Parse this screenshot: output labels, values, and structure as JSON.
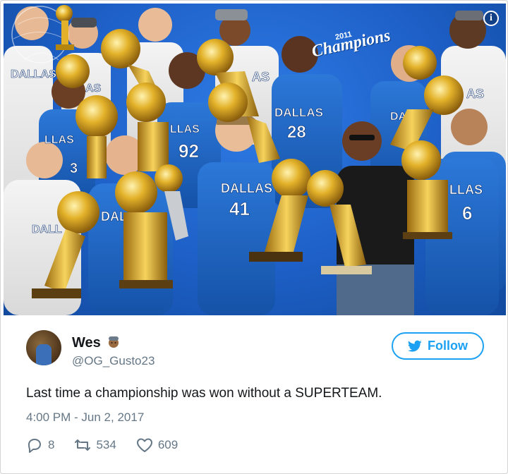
{
  "photo": {
    "info_icon_label": "i",
    "logo": {
      "year": "2011",
      "word": "Champions"
    },
    "jerseys": {
      "team": "DALLAS",
      "team_partial_1": "DALLAS",
      "team_partial_2": "LLAS",
      "team_partial_3": "DALL",
      "team_partial_4": "LLAS",
      "team_partial_5": "DAL",
      "team_partial_6": "DALL",
      "team_partial_7": "LLAS",
      "team_partial_8": "AS",
      "team_partial_9": "AS",
      "team_partial_10": "LLAS",
      "num_3": "3",
      "num_92": "92",
      "num_28": "28",
      "num_41": "41",
      "num_6": "6"
    }
  },
  "tweet": {
    "display_name": "Wes",
    "handle": "@OG_Gusto23",
    "follow_label": "Follow",
    "text": "Last time a championship was won without a SUPERTEAM.",
    "timestamp": "4:00 PM - Jun 2, 2017",
    "replies": "8",
    "retweets": "534",
    "likes": "609"
  },
  "colors": {
    "accent": "#1da1f2",
    "text": "#14171a",
    "muted": "#657786",
    "photo_blue": "#1d5fc6",
    "gold": "#e3b22a"
  }
}
